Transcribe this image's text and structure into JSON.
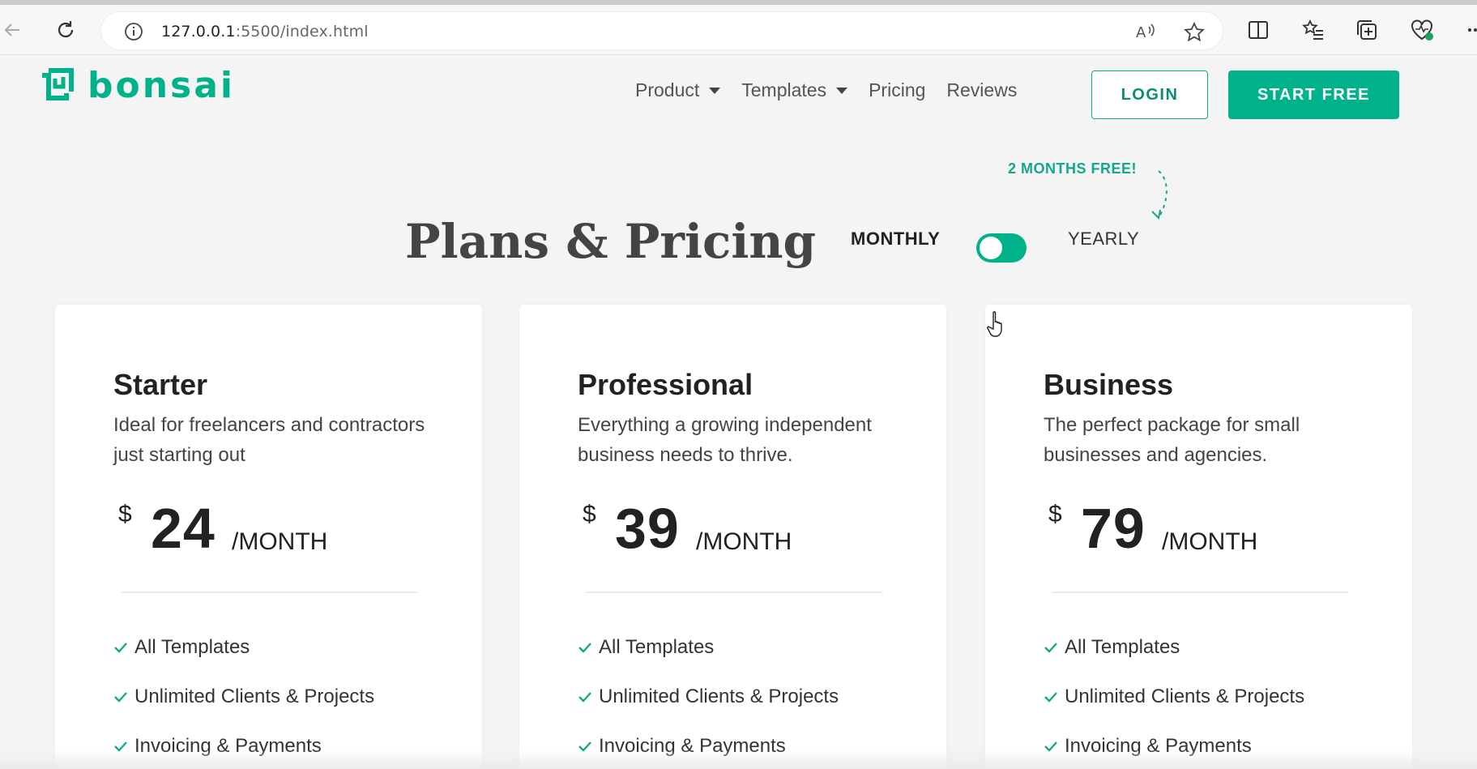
{
  "browser": {
    "url_host": "127.0.0.1",
    "url_rest": ":5500/index.html"
  },
  "brand": {
    "name": "bonsai",
    "accent": "#00b289"
  },
  "nav": {
    "items": [
      {
        "label": "Product",
        "dropdown": true
      },
      {
        "label": "Templates",
        "dropdown": true
      },
      {
        "label": "Pricing",
        "dropdown": false
      },
      {
        "label": "Reviews",
        "dropdown": false
      }
    ],
    "login_label": "LOGIN",
    "start_label": "START FREE"
  },
  "pricing": {
    "title": "Plans & Pricing",
    "promo": "2 MONTHS FREE!",
    "toggle_left": "MONTHLY",
    "toggle_right": "YEARLY",
    "billing": "monthly"
  },
  "plans": [
    {
      "name": "Starter",
      "description": "Ideal for freelancers and contractors just starting out",
      "currency": "$",
      "price": "24",
      "period": "/MONTH",
      "features": [
        "All Templates",
        "Unlimited Clients & Projects",
        "Invoicing & Payments"
      ]
    },
    {
      "name": "Professional",
      "description": "Everything a growing independent business needs to thrive.",
      "currency": "$",
      "price": "39",
      "period": "/MONTH",
      "features": [
        "All Templates",
        "Unlimited Clients & Projects",
        "Invoicing & Payments"
      ]
    },
    {
      "name": "Business",
      "description": "The perfect package for small businesses and agencies.",
      "currency": "$",
      "price": "79",
      "period": "/MONTH",
      "features": [
        "All Templates",
        "Unlimited Clients & Projects",
        "Invoicing & Payments"
      ]
    }
  ]
}
